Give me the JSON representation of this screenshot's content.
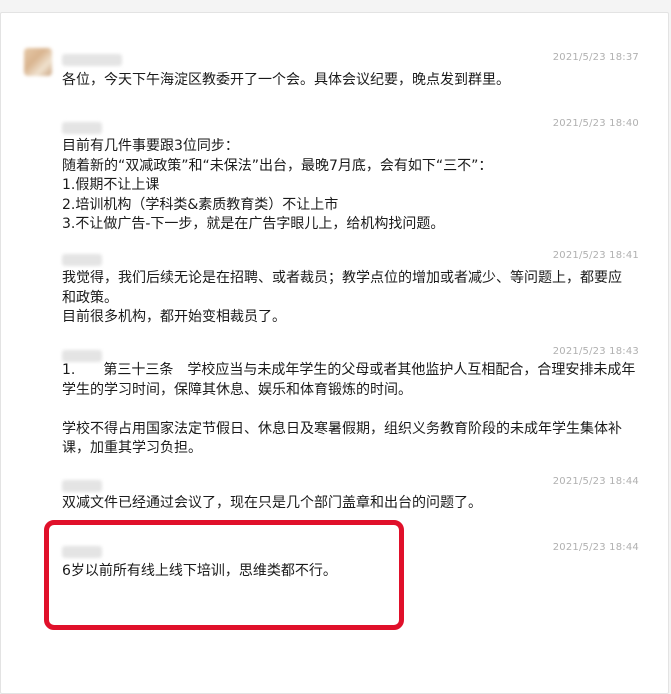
{
  "accent_color": "#e0102a",
  "messages": [
    {
      "time": "2021/5/23 18:37",
      "lines": [
        "各位，今天下午海淀区教委开了一个会。具体会议纪要，晚点发到群里。"
      ]
    },
    {
      "time": "2021/5/23 18:40",
      "lines": [
        "目前有几件事要跟3位同步：",
        "随着新的“双减政策”和“未保法”出台，最晚7月底，会有如下“三不”：",
        "1.假期不让上课",
        "2.培训机构（学科类&素质教育类）不让上市",
        "3.不让做广告-下一步，就是在广告字眼儿上，给机构找问题。"
      ]
    },
    {
      "time": "2021/5/23 18:41",
      "lines": [
        "我觉得，我们后续无论是在招聘、或者裁员；教学点位的增加或者减少、等问题上，都要应",
        "和政策。",
        "目前很多机构，都开始变相裁员了。"
      ]
    },
    {
      "time": "2021/5/23 18:43",
      "lines": [
        "1.　　第三十三条　学校应当与未成年学生的父母或者其他监护人互相配合，合理安排未成年",
        "学生的学习时间，保障其休息、娱乐和体育锻炼的时间。",
        "",
        "学校不得占用国家法定节假日、休息日及寒暑假期，组织义务教育阶段的未成年学生集体补",
        "课，加重其学习负担。"
      ]
    },
    {
      "time": "2021/5/23 18:44",
      "lines": [
        "双减文件已经通过会议了，现在只是几个部门盖章和出台的问题了。"
      ]
    },
    {
      "time": "2021/5/23 18:44",
      "lines": [
        "6岁以前所有线上线下培训，思维类都不行。"
      ]
    }
  ]
}
